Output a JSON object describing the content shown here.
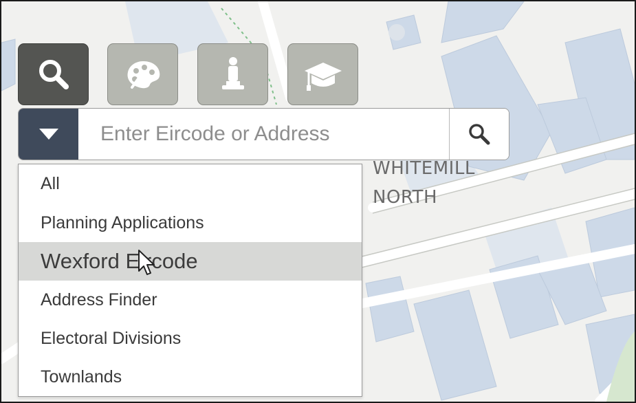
{
  "map": {
    "place_label_line1": "WHITEMILL",
    "place_label_line2": "NORTH",
    "colors": {
      "background": "#f1f1ef",
      "building": "#ccd8e8",
      "road": "#ffffff"
    }
  },
  "theme_buttons": [
    {
      "name": "search",
      "icon": "magnifier-icon",
      "active": true
    },
    {
      "name": "arts",
      "icon": "palette-icon",
      "active": false
    },
    {
      "name": "monument",
      "icon": "statue-icon",
      "active": false
    },
    {
      "name": "education",
      "icon": "mortarboard-icon",
      "active": false
    }
  ],
  "search": {
    "placeholder": "Enter Eircode or Address",
    "value": "",
    "toggle_icon": "caret-down-icon",
    "button_icon": "search-icon",
    "accent": "#3f4a5b"
  },
  "menu": {
    "items": [
      {
        "label": "All"
      },
      {
        "label": "Planning Applications"
      },
      {
        "label": "Wexford Eircode",
        "highlighted": true
      },
      {
        "label": "Address Finder"
      },
      {
        "label": "Electoral Divisions"
      },
      {
        "label": "Townlands"
      }
    ]
  }
}
